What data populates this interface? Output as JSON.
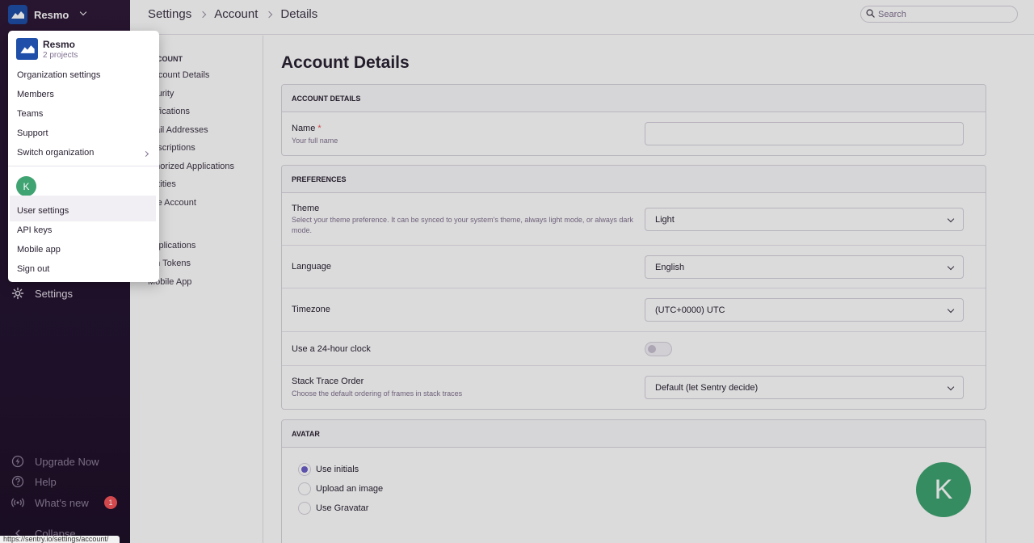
{
  "sidebar": {
    "org_name": "Resmo",
    "settings_label": "Settings",
    "upgrade_label": "Upgrade Now",
    "help_label": "Help",
    "whats_new_label": "What's new",
    "whats_new_count": "1",
    "collapse_label": "Collapse"
  },
  "status_url": "https://sentry.io/settings/account/",
  "breadcrumb": {
    "items": [
      "Settings",
      "Account",
      "Details"
    ]
  },
  "search": {
    "placeholder": "Search"
  },
  "settings_nav": {
    "section_account": "ACCOUNT",
    "items": [
      "Account Details",
      "ecurity",
      "otifications",
      "mail Addresses",
      "ubscriptions",
      "uthorized Applications",
      "entities",
      "ose Account"
    ],
    "items_api": [
      "Applications",
      "uth Tokens",
      "Mobile App"
    ]
  },
  "main": {
    "title": "Account Details",
    "account_details": {
      "header": "ACCOUNT DETAILS",
      "name_label": "Name",
      "name_required": "*",
      "name_help": "Your full name",
      "name_value": ""
    },
    "preferences": {
      "header": "PREFERENCES",
      "theme_label": "Theme",
      "theme_help": "Select your theme preference. It can be synced to your system's theme, always light mode, or always dark mode.",
      "theme_value": "Light",
      "language_label": "Language",
      "language_value": "English",
      "timezone_label": "Timezone",
      "timezone_value": "(UTC+0000) UTC",
      "clock_label": "Use a 24-hour clock",
      "clock_on": false,
      "stack_label": "Stack Trace Order",
      "stack_help": "Choose the default ordering of frames in stack traces",
      "stack_value": "Default (let Sentry decide)"
    },
    "avatar": {
      "header": "AVATAR",
      "options": [
        "Use initials",
        "Upload an image",
        "Use Gravatar"
      ],
      "selected": "Use initials",
      "initial": "K"
    }
  },
  "dropdown": {
    "org_name": "Resmo",
    "org_sub": "2 projects",
    "org_items": [
      "Organization settings",
      "Members",
      "Teams",
      "Support",
      "Switch organization"
    ],
    "user_initial": "K",
    "user_items": [
      "User settings",
      "API keys",
      "Mobile app",
      "Sign out"
    ]
  },
  "colors": {
    "sidebar_bg": "#2f1937",
    "accent": "#6c5fc7",
    "avatar_green": "#3fa372",
    "badge_red": "#f55459",
    "org_logo": "#1f4fa8"
  }
}
